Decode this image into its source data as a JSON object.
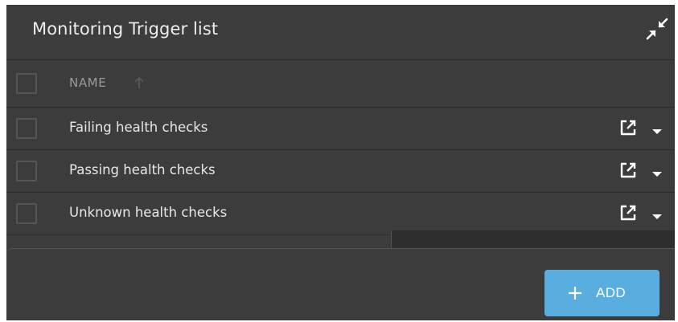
{
  "panel": {
    "title": "Monitoring Trigger list"
  },
  "table": {
    "columns": [
      {
        "label": "NAME",
        "sort": "ascending"
      }
    ],
    "rows": [
      {
        "name": "Failing health checks"
      },
      {
        "name": "Passing health checks"
      },
      {
        "name": "Unknown health checks"
      }
    ]
  },
  "footer": {
    "add_label": "ADD"
  },
  "icons": {
    "collapse": "collapse-arrows-icon",
    "sort": "arrow-up-icon",
    "open": "open-external-icon",
    "menu": "caret-down-icon",
    "add": "plus-icon"
  },
  "colors": {
    "panel_bg": "#3c3c3c",
    "accent": "#5aaedf",
    "text": "#e8e8e8",
    "muted": "#9a9a9a"
  }
}
